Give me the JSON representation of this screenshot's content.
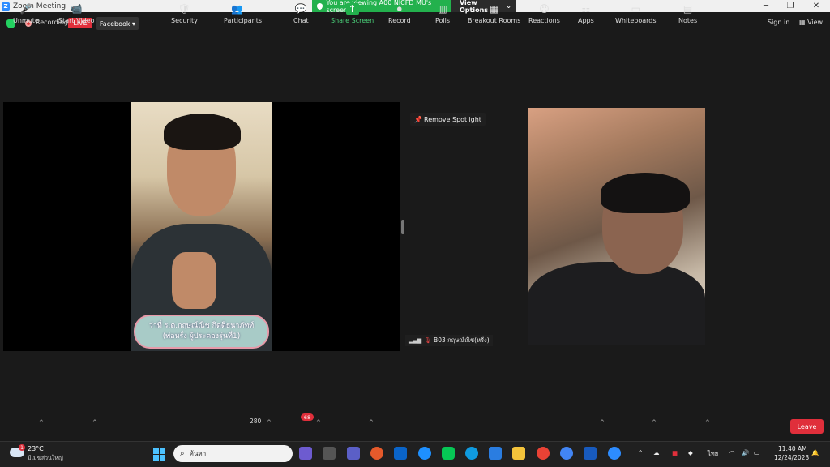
{
  "window": {
    "title": "Zoom Meeting",
    "minimize": "─",
    "maximize": "❐",
    "close": "✕"
  },
  "banner": {
    "viewing_text": "You are viewing A00 NICFD MU's screen",
    "view_options": "View Options",
    "caret": "⌄"
  },
  "topbar": {
    "recording": "Recording",
    "live": "LIVE",
    "platform": "Facebook ▾",
    "sign_in": "Sign in",
    "view": "View"
  },
  "video": {
    "caption_line1": "ว่าที่ ร.ต.กฤษณ์ณิช กิตติธนาภัทท์",
    "caption_line2": "(พ่อหรั่ง ผู้ประคองรุ่นที่1)",
    "remove_spotlight": "Remove Spotlight",
    "participant_name": "B03 กฤษณ์ณิช(หรั่ง)"
  },
  "toolbar": {
    "unmute": "Unmute",
    "start_video": "Start Video",
    "security": "Security",
    "participants": "Participants",
    "participants_count": "280",
    "chat": "Chat",
    "chat_badge": "68",
    "share_screen": "Share Screen",
    "record": "Record",
    "polls": "Polls",
    "breakout_rooms": "Breakout Rooms",
    "reactions": "Reactions",
    "apps": "Apps",
    "whiteboards": "Whiteboards",
    "notes": "Notes",
    "leave": "Leave",
    "caret": "^"
  },
  "taskbar": {
    "temperature": "23°C",
    "weather_desc": "มีเมฆส่วนใหญ่",
    "weather_badge": "1",
    "search_placeholder": "ค้นหา",
    "language": "ไทย",
    "time": "11:40 AM",
    "date": "12/24/2023"
  },
  "colors": {
    "zoom_blue": "#2d8cff",
    "green": "#23b14d",
    "red": "#e02f3b",
    "background": "#1a1a1a"
  }
}
